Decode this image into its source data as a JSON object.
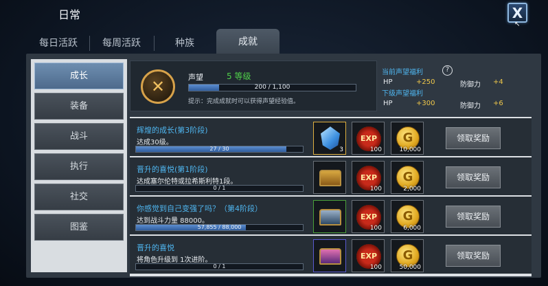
{
  "window": {
    "title": "日常",
    "close_label": "X"
  },
  "tabs": [
    {
      "label": "每日活跃",
      "active": false
    },
    {
      "label": "每周活跃",
      "active": false
    },
    {
      "label": "种族",
      "active": false
    },
    {
      "label": "成就",
      "active": true
    }
  ],
  "sidebar": {
    "items": [
      {
        "label": "成长",
        "active": true
      },
      {
        "label": "装备",
        "active": false
      },
      {
        "label": "战斗",
        "active": false
      },
      {
        "label": "执行",
        "active": false
      },
      {
        "label": "社交",
        "active": false
      },
      {
        "label": "图鉴",
        "active": false
      }
    ]
  },
  "reputation": {
    "label": "声望",
    "level_text": "5 等级",
    "progress_text": "200 / 1,100",
    "progress_value": 200,
    "progress_max": 1100,
    "tip": "提示：完成成就时可以获得声望经验值。"
  },
  "bonus": {
    "current_heading": "当前声望福利",
    "next_heading": "下级声望福利",
    "current": [
      {
        "stat": "HP",
        "value": "+250"
      },
      {
        "stat": "防御力",
        "value": "+4"
      }
    ],
    "next": [
      {
        "stat": "HP",
        "value": "+300"
      },
      {
        "stat": "防御力",
        "value": "+6"
      }
    ],
    "help_icon": "question-circle-icon"
  },
  "achievements": [
    {
      "title": "辉煌的成长(第3阶段)",
      "description": "达成30级。",
      "progress_text": "27 / 30",
      "progress_fraction": 0.9,
      "rewards": [
        {
          "icon": "blue-gem-icon",
          "count": "3"
        },
        {
          "icon": "exp-orb-icon",
          "count": "100"
        },
        {
          "icon": "gold-coin-icon",
          "count": "10,000"
        }
      ],
      "button_label": "领取奖励"
    },
    {
      "title": "晋升的喜悦(第1阶段)",
      "description": "达成塞尔伦特或拉希斯利特1段。",
      "progress_text": "0 / 1",
      "progress_fraction": 0,
      "rewards": [
        {
          "icon": "gold-chest-icon",
          "count": ""
        },
        {
          "icon": "exp-orb-icon",
          "count": "100"
        },
        {
          "icon": "gold-coin-icon",
          "count": "2,000"
        }
      ],
      "button_label": "领取奖励"
    },
    {
      "title": "你感觉到自己变强了吗？（第4阶段）",
      "description": "达到战斗力量 88000。",
      "progress_text": "57,855 / 88,000",
      "progress_fraction": 0.657,
      "rewards": [
        {
          "icon": "green-chest-icon",
          "count": ""
        },
        {
          "icon": "exp-orb-icon",
          "count": "100"
        },
        {
          "icon": "gold-coin-icon",
          "count": "6,000"
        }
      ],
      "button_label": "领取奖励"
    },
    {
      "title": "晋升的喜悦",
      "description": "将角色升级到 1次进阶。",
      "progress_text": "0 / 1",
      "progress_fraction": 0,
      "rewards": [
        {
          "icon": "purple-chest-icon",
          "count": ""
        },
        {
          "icon": "exp-orb-icon",
          "count": "100"
        },
        {
          "icon": "gold-coin-icon",
          "count": "50,000"
        }
      ],
      "button_label": "领取奖励"
    }
  ],
  "item_glyphs": {
    "exp": "EXP",
    "coin": "G",
    "medal": "✕",
    "help": "?"
  },
  "colors": {
    "accent_blue": "#4fb6f0",
    "level_green": "#4fd04a",
    "bonus_gold": "#f0c84a",
    "progress_fill": "#3d6fb5"
  }
}
